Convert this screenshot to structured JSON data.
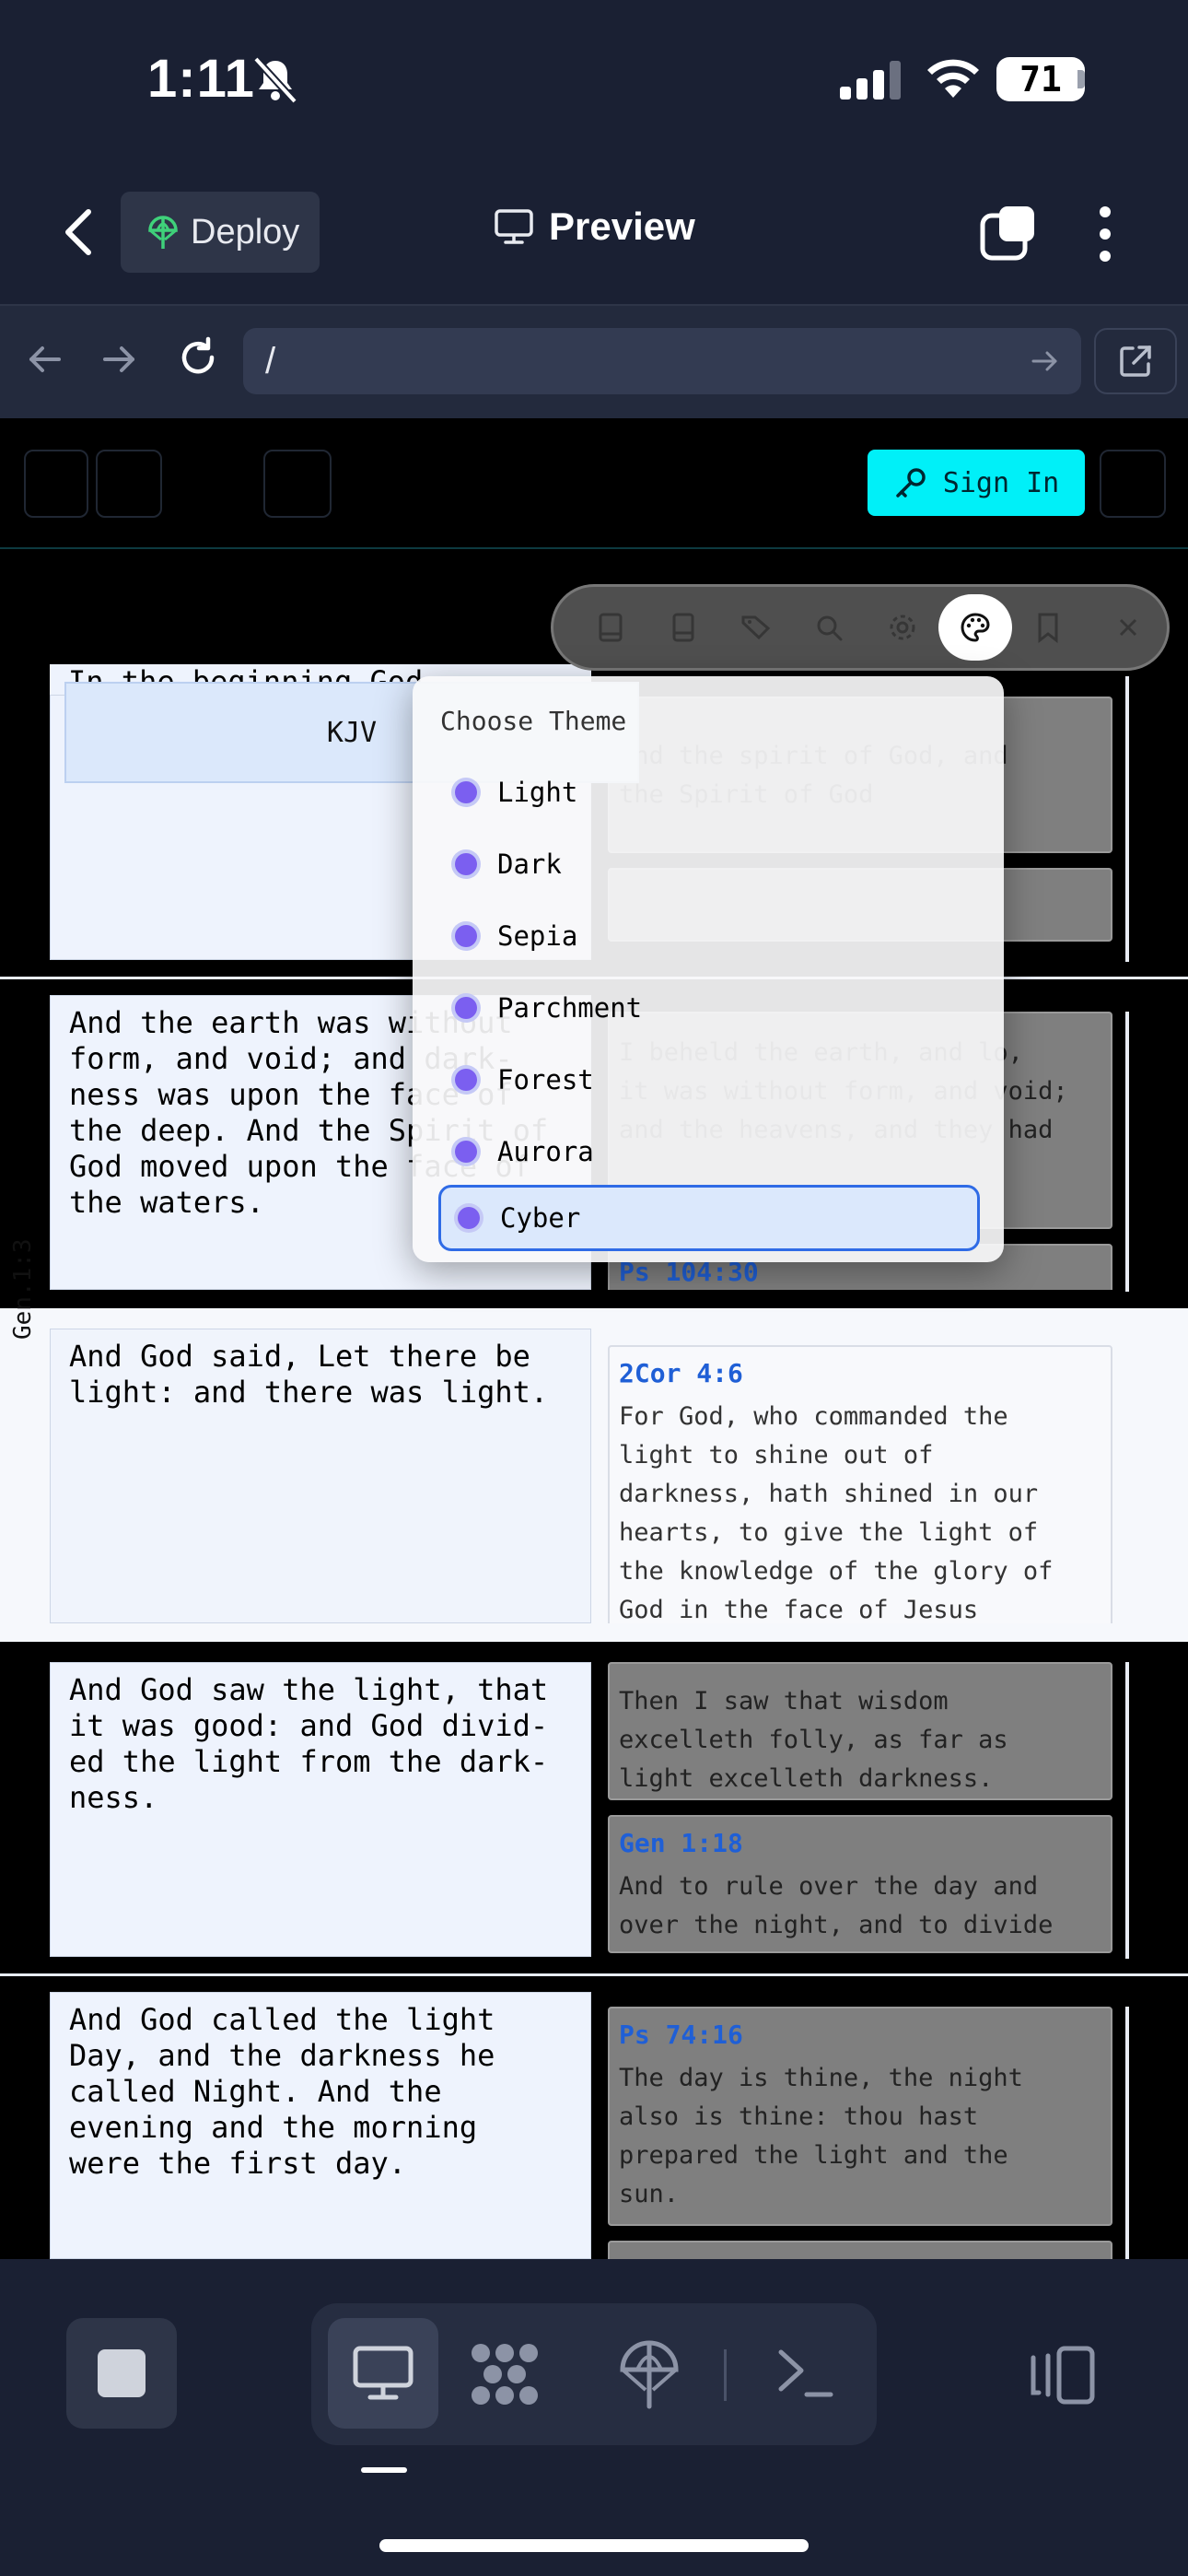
{
  "status_bar": {
    "time": "1:11",
    "battery": "71"
  },
  "header": {
    "deploy_label": "Deploy",
    "title": "Preview"
  },
  "browser": {
    "url": "/"
  },
  "site": {
    "sign_in_label": "Sign In",
    "version_label": "KJV",
    "hidden_top_text": "In the beginning God",
    "theme_menu": {
      "title": "Choose Theme",
      "items": [
        "Light",
        "Dark",
        "Sepia",
        "Parchment",
        "Forest",
        "Aurora",
        "Cyber"
      ],
      "selected": "Cyber"
    },
    "side_label": "Gen.1:3",
    "verses": [
      {
        "text": "And the earth was without\nform, and void; and dark-\nness was upon the face of\nthe deep. And the Spirit of\nGod moved upon the face of\nthe waters.",
        "refs": [
          {
            "id": "",
            "text": "I beheld the earth, and lo,\nit was without form, and void;\nand the heavens, and they had"
          },
          {
            "id": "Ps 104:30",
            "text": ""
          }
        ]
      },
      {
        "text": "And God said, Let there be\nlight: and there was light.",
        "refs": [
          {
            "id": "2Cor 4:6",
            "text": "For God, who commanded the\nlight to shine out of\ndarkness, hath shined in our\nhearts, to give the light of\nthe knowledge of the glory of\nGod in the face of Jesus"
          }
        ]
      },
      {
        "text": "And God saw the light, that\nit was good: and God divid-\ned the light from the dark-\nness.",
        "refs": [
          {
            "id": "",
            "text": "Then I saw that wisdom\nexcelleth folly, as far as\nlight excelleth darkness."
          },
          {
            "id": "Gen 1:18",
            "text": "And to rule over the day and\nover the night, and to divide"
          }
        ]
      },
      {
        "text": "And God called the light\nDay, and the darkness he\ncalled Night. And the\nevening and the morning\nwere the first day.",
        "refs": [
          {
            "id": "Ps 74:16",
            "text": "The day is thine, the night\nalso is thine: thou hast\nprepared the light and the\nsun."
          }
        ]
      }
    ],
    "top_refs": [
      {
        "text": "and the spirit of God, and\nthe Spirit of God"
      }
    ]
  },
  "colors": {
    "accent": "#00f0f8",
    "link": "#1f5fd6",
    "selected_border": "#2f6be6",
    "theme_dot": "#7b5ff0"
  }
}
